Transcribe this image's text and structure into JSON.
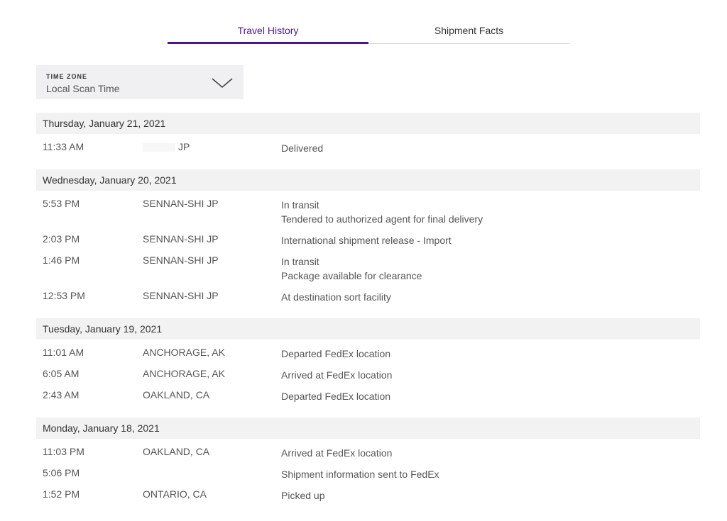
{
  "tabs": {
    "travel_history": "Travel History",
    "shipment_facts": "Shipment Facts"
  },
  "time_zone": {
    "label": "TIME ZONE",
    "value": "Local Scan Time"
  },
  "days": [
    {
      "date": "Thursday, January 21, 2021",
      "events": [
        {
          "time": "11:33 AM",
          "location": "JP",
          "status": "Delivered",
          "detail": ""
        }
      ]
    },
    {
      "date": "Wednesday, January 20, 2021",
      "events": [
        {
          "time": "5:53 PM",
          "location": "SENNAN-SHI JP",
          "status": "In transit",
          "detail": "Tendered to authorized agent for final delivery"
        },
        {
          "time": "2:03 PM",
          "location": "SENNAN-SHI JP",
          "status": "International shipment release - Import",
          "detail": ""
        },
        {
          "time": "1:46 PM",
          "location": "SENNAN-SHI JP",
          "status": "In transit",
          "detail": "Package available for clearance"
        },
        {
          "time": "12:53 PM",
          "location": "SENNAN-SHI JP",
          "status": "At destination sort facility",
          "detail": ""
        }
      ]
    },
    {
      "date": "Tuesday, January 19, 2021",
      "events": [
        {
          "time": "11:01 AM",
          "location": "ANCHORAGE, AK",
          "status": "Departed FedEx location",
          "detail": ""
        },
        {
          "time": "6:05 AM",
          "location": "ANCHORAGE, AK",
          "status": "Arrived at FedEx location",
          "detail": ""
        },
        {
          "time": "2:43 AM",
          "location": "OAKLAND, CA",
          "status": "Departed FedEx location",
          "detail": ""
        }
      ]
    },
    {
      "date": "Monday, January 18, 2021",
      "events": [
        {
          "time": "11:03 PM",
          "location": "OAKLAND, CA",
          "status": "Arrived at FedEx location",
          "detail": ""
        },
        {
          "time": "5:06 PM",
          "location": "",
          "status": "Shipment information sent to FedEx",
          "detail": ""
        },
        {
          "time": "1:52 PM",
          "location": "ONTARIO, CA",
          "status": "Picked up",
          "detail": ""
        }
      ]
    }
  ],
  "colors": {
    "accent": "#4d148c",
    "day_header_bg": "#f2f2f2",
    "dropdown_bg": "#f0f0f2"
  },
  "icons": {
    "dropdown": "chevron-down-icon"
  }
}
